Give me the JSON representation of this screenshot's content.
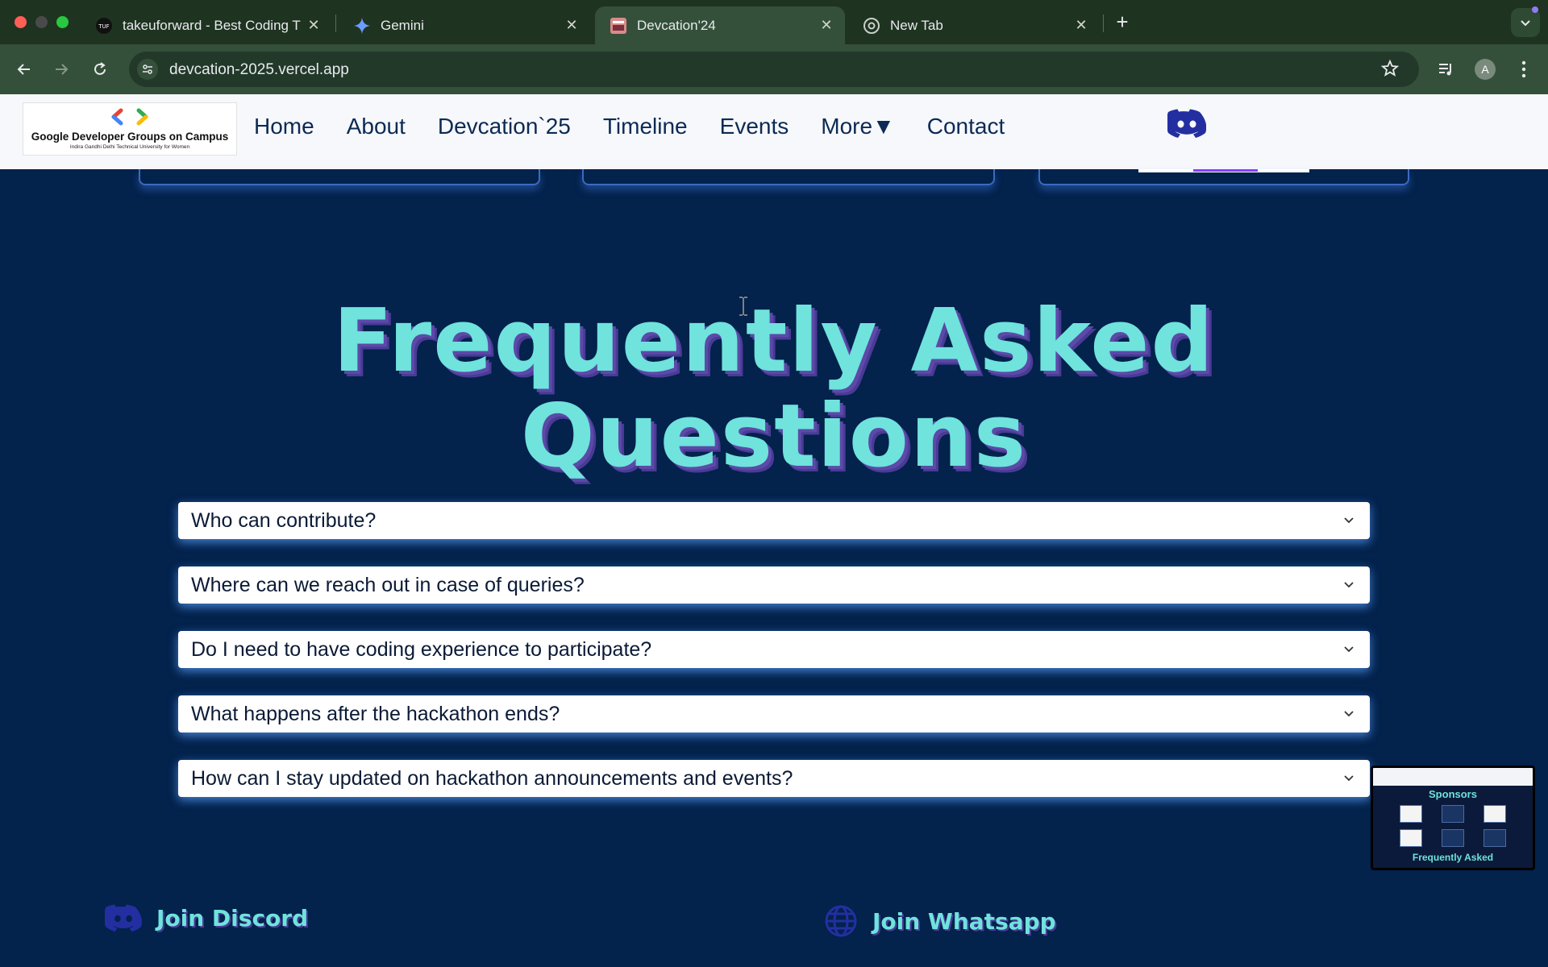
{
  "browser": {
    "tabs": [
      {
        "title": "takeuforward - Best Coding T",
        "favicon": "tuf-icon"
      },
      {
        "title": "Gemini",
        "favicon": "gemini-icon"
      },
      {
        "title": "Devcation'24",
        "favicon": "devcation-icon",
        "active": true
      },
      {
        "title": "New Tab",
        "favicon": "chrome-icon"
      }
    ],
    "url": "devcation-2025.vercel.app",
    "profile_initial": "A"
  },
  "header": {
    "logo_title": "Google Developer Groups on Campus",
    "logo_subtitle": "Indira Gandhi Delhi Technical University for Women",
    "nav": [
      "Home",
      "About",
      "Devcation`25",
      "Timeline",
      "Events",
      "More▼",
      "Contact"
    ]
  },
  "faq": {
    "title_line1": "Frequently Asked",
    "title_line2": "Questions",
    "questions": [
      "Who can contribute?",
      "Where can we reach out in case of queries?",
      "Do I need to have coding experience to participate?",
      "What happens after the hackathon ends?",
      "How can I stay updated on hackathon announcements and events?"
    ]
  },
  "preview": {
    "heading": "Sponsors",
    "footer": "Frequently Asked"
  },
  "footer": {
    "discord_label": "Join Discord",
    "whatsapp_label": "Join Whatsapp"
  },
  "colors": {
    "page_bg": "#03224c",
    "accent_teal": "#6fe3dc",
    "accent_purple": "#4a3a96",
    "discord_blue": "#232fa0"
  }
}
